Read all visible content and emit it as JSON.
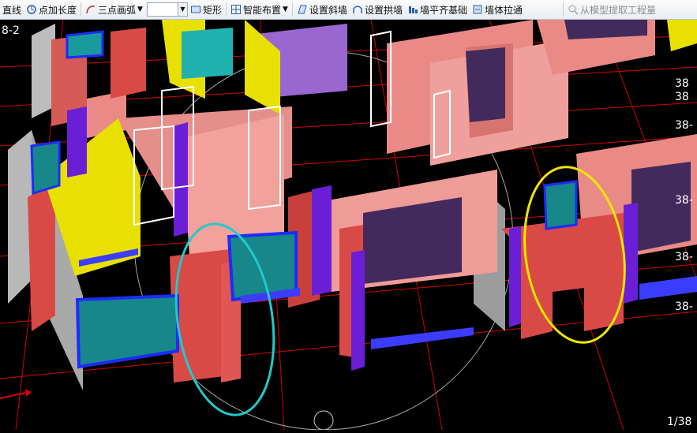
{
  "toolbar": {
    "line": "直线",
    "point_add_length": "点加长度",
    "three_point_arc": "三点画弧",
    "rectangle": "矩形",
    "smart_layout": "智能布置",
    "set_slope_wall": "设置斜墙",
    "set_arch_wall": "设置拱墙",
    "wall_align_foundation": "墙平齐基础",
    "wall_stretch": "墙体拉通",
    "extract_from_model": "从模型提取工程量"
  },
  "axis_labels": {
    "top_left": "8-2",
    "right_1": "38",
    "right_2": "38",
    "right_3": "38-",
    "right_4": "38-",
    "right_5": "38-",
    "right_6": "38-",
    "bottom_right": "1/38"
  },
  "colors": {
    "wall_pink": "#e98a86",
    "wall_red": "#d94a46",
    "wall_yellow": "#e8e000",
    "wall_purple": "#6a1fd6",
    "window_teal": "#17878a",
    "highlight_cyan": "#22c9c9",
    "highlight_yellow": "#f2e600",
    "grid_red": "#e00000"
  }
}
